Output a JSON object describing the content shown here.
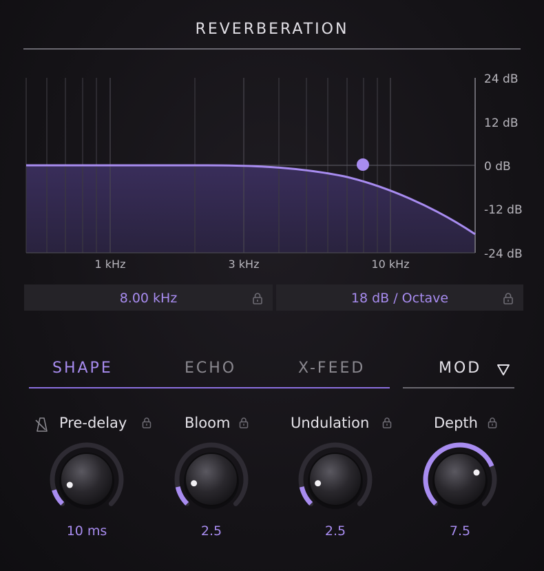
{
  "title": "REVERBERATION",
  "eq": {
    "y_labels": [
      "24 dB",
      "12 dB",
      "0 dB",
      "-12 dB",
      "-24 dB"
    ],
    "x_labels": [
      "1 kHz",
      "3 kHz",
      "10 kHz"
    ],
    "cutoff": "8.00 kHz",
    "slope": "18 dB / Octave"
  },
  "tabs": {
    "shape": "SHAPE",
    "echo": "ECHO",
    "xfeed": "X-FEED",
    "mod": "MOD"
  },
  "knobs": [
    {
      "label": "Pre-delay",
      "value": "10 ms",
      "level": 0.1
    },
    {
      "label": "Bloom",
      "value": "2.5",
      "level": 0.12
    },
    {
      "label": "Undulation",
      "value": "2.5",
      "level": 0.12
    },
    {
      "label": "Depth",
      "value": "7.5",
      "level": 0.75
    }
  ],
  "colors": {
    "accent": "#a88cf0",
    "accent_dark": "#7a60c8",
    "track": "#2e2b33",
    "fill": "#3a2f5a"
  }
}
